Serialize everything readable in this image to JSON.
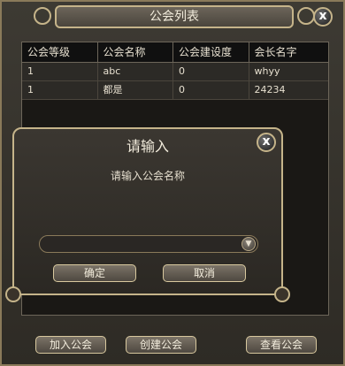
{
  "window": {
    "title": "公会列表",
    "close_symbol": "x"
  },
  "table": {
    "columns": [
      "公会等级",
      "公会名称",
      "公会建设度",
      "会长名字"
    ],
    "rows": [
      [
        "1",
        "abc",
        "0",
        "whyy"
      ],
      [
        "1",
        "都是",
        "0",
        "24234"
      ]
    ]
  },
  "buttons": {
    "join": "加入公会",
    "create": "创建公会",
    "view": "查看公会"
  },
  "modal": {
    "title": "请输入",
    "message": "请输入公会名称",
    "input_value": "",
    "confirm": "确定",
    "cancel": "取消",
    "close_symbol": "x",
    "dropdown_symbol": "▼"
  },
  "colors": {
    "frame_gold": "#c5b48a",
    "panel": "#3b3731",
    "text": "#f2ecdc"
  }
}
